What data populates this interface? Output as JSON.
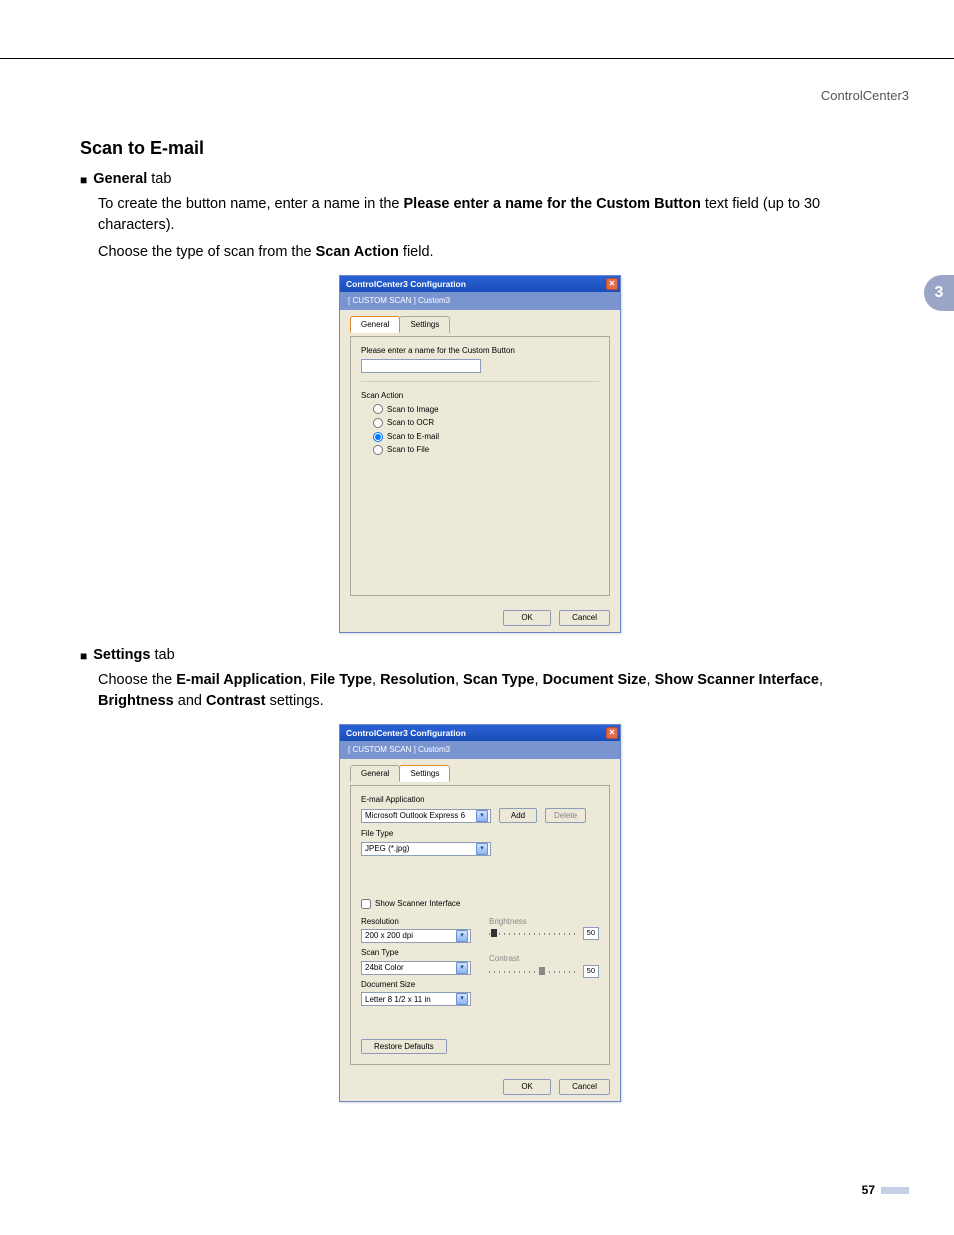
{
  "header": {
    "product": "ControlCenter3"
  },
  "sideTab": {
    "label": "3"
  },
  "section": {
    "title": "Scan to E-mail",
    "bullet1_label": "General",
    "bullet1_suffix": " tab",
    "para1_a": "To create the button name, enter a name in the ",
    "para1_b": "Please enter a name for the Custom Button",
    "para1_c": " text field (up to 30 characters).",
    "para2_a": "Choose the type of scan from the ",
    "para2_b": "Scan Action",
    "para2_c": " field.",
    "bullet2_label": "Settings",
    "bullet2_suffix": " tab",
    "para3_a": "Choose the ",
    "p3_1": "E-mail Application",
    "p3_2": "File Type",
    "p3_3": "Resolution",
    "p3_4": "Scan Type",
    "p3_5": "Document Size",
    "p3_6": "Show Scanner Interface",
    "p3_7": "Brightness",
    "p3_8": "Contrast",
    "para3_b": " settings.",
    "sep": ", ",
    "and": " and "
  },
  "dlg1": {
    "title": "ControlCenter3 Configuration",
    "subtitle": "[ CUSTOM SCAN ]   Custom3",
    "tab_general": "General",
    "tab_settings": "Settings",
    "label_name": "Please enter a name for the Custom Button",
    "name_value": "",
    "scan_action": "Scan Action",
    "r1": "Scan to Image",
    "r2": "Scan to OCR",
    "r3": "Scan to E-mail",
    "r4": "Scan to File",
    "ok": "OK",
    "cancel": "Cancel"
  },
  "dlg2": {
    "title": "ControlCenter3 Configuration",
    "subtitle": "[ CUSTOM SCAN ]   Custom3",
    "tab_general": "General",
    "tab_settings": "Settings",
    "lbl_emailapp": "E-mail Application",
    "val_emailapp": "Microsoft Outlook Express 6",
    "btn_add": "Add",
    "btn_delete": "Delete",
    "lbl_filetype": "File Type",
    "val_filetype": "JPEG (*.jpg)",
    "chk_show": "Show Scanner Interface",
    "lbl_res": "Resolution",
    "val_res": "200 x 200 dpi",
    "lbl_scantype": "Scan Type",
    "val_scantype": "24bit Color",
    "lbl_docsize": "Document Size",
    "val_docsize": "Letter 8 1/2 x 11 in",
    "lbl_bright": "Brightness",
    "val_bright": "50",
    "lbl_contrast": "Contrast",
    "val_contrast": "50",
    "btn_restore": "Restore Defaults",
    "ok": "OK",
    "cancel": "Cancel"
  },
  "footer": {
    "page": "57"
  }
}
